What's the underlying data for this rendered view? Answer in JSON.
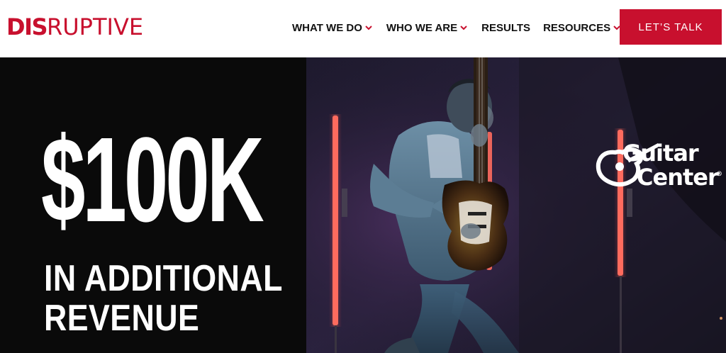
{
  "header": {
    "logo": {
      "bold_part": "DIS",
      "thin_part": "RUPTIVE"
    },
    "nav": [
      {
        "label": "WHAT WE DO",
        "has_dropdown": true
      },
      {
        "label": "WHO WE ARE",
        "has_dropdown": true
      },
      {
        "label": "RESULTS",
        "has_dropdown": false
      },
      {
        "label": "RESOURCES",
        "has_dropdown": true
      }
    ],
    "cta_label": "LET’S TALK"
  },
  "hero": {
    "stat_value": "$100K",
    "stat_line1": "IN ADDITIONAL",
    "stat_line2": "REVENUE",
    "client_logo": {
      "line1": "Guitar",
      "line2": "Center",
      "trademark": "®"
    }
  },
  "colors": {
    "brand_red": "#c8102e",
    "nav_text": "#111111",
    "hero_bg": "#0a0a0a",
    "hero_text": "#ffffff"
  },
  "icons": {
    "nav_dropdown": "chevron-down-icon",
    "client_logo_mark": "guitar-icon"
  }
}
